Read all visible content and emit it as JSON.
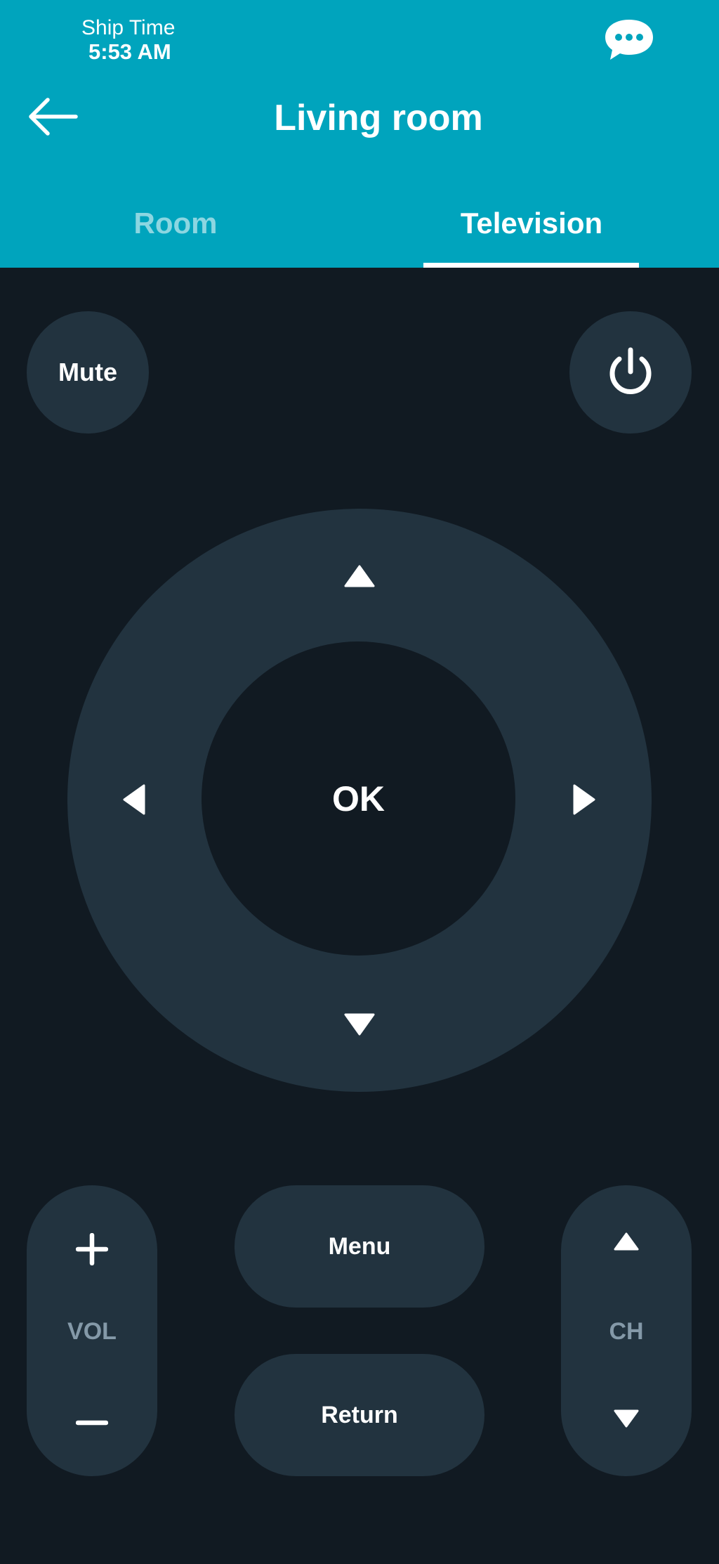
{
  "status": {
    "ship_label": "Ship Time",
    "ship_time": "5:53 AM"
  },
  "header": {
    "title": "Living room",
    "back_icon": "arrow-left-icon",
    "chat_icon": "chat-bubble-icon"
  },
  "tabs": [
    {
      "label": "Room",
      "active": false
    },
    {
      "label": "Television",
      "active": true
    }
  ],
  "remote": {
    "mute_label": "Mute",
    "power_icon": "power-icon",
    "ok_label": "OK",
    "volume_label": "VOL",
    "channel_label": "CH",
    "menu_label": "Menu",
    "return_label": "Return"
  },
  "colors": {
    "header_bg": "#00a4bd",
    "screen_bg": "#111a22",
    "button_bg": "#22333f",
    "muted_text": "#8499a8"
  }
}
